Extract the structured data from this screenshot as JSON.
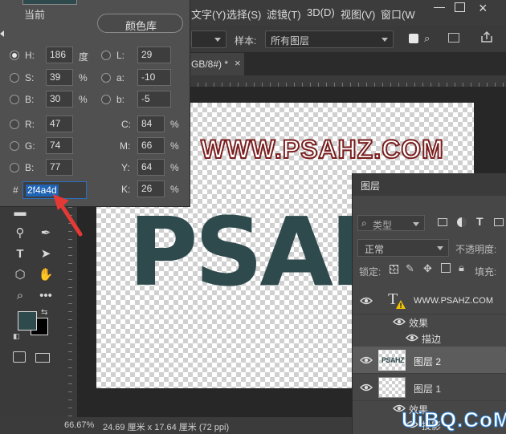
{
  "menu": {
    "items": [
      "文字(Y)",
      "选择(S)",
      "滤镜(T)",
      "3D(D)",
      "视图(V)",
      "窗口(W"
    ]
  },
  "options": {
    "sample_label": "样本:",
    "sample_value": "所有图层"
  },
  "tab": {
    "title": "GB/8#) *",
    "close": "×"
  },
  "picker": {
    "current_label": "当前",
    "library_button": "颜色库",
    "hsb": {
      "h_label": "H:",
      "h": "186",
      "h_unit": "度",
      "s_label": "S:",
      "s": "39",
      "s_unit": "%",
      "b_label": "B:",
      "b": "30",
      "b_unit": "%"
    },
    "lab": {
      "l_label": "L:",
      "l": "29",
      "a_label": "a:",
      "a": "-10",
      "b_label": "b:",
      "b": "-5"
    },
    "rgb": {
      "r_label": "R:",
      "r": "47",
      "g_label": "G:",
      "g": "74",
      "b_label": "B:",
      "b": "77"
    },
    "cmyk": {
      "c_label": "C:",
      "c": "84",
      "c_unit": "%",
      "m_label": "M:",
      "m": "66",
      "m_unit": "%",
      "y_label": "Y:",
      "y": "64",
      "y_unit": "%",
      "k_label": "K:",
      "k": "26",
      "k_unit": "%"
    },
    "hex_label": "#",
    "hex": "2f4a4d",
    "selected_color": "#2f4a4d"
  },
  "canvas": {
    "watermark": "WWW.PSAHZ.COM",
    "art_text": "PSAHZ"
  },
  "layers": {
    "title": "图层",
    "filter_placeholder": "类型",
    "blend_mode": "正常",
    "opacity_label": "不透明度:",
    "lock_label": "锁定:",
    "fill_label": "填充:",
    "rows": [
      {
        "name": "WWW.PSAHZ.COM",
        "type": "text"
      },
      {
        "name": "效果",
        "type": "effects"
      },
      {
        "name": "描边",
        "type": "effect"
      },
      {
        "name": "图层 2",
        "type": "pixel",
        "thumb_text": "PSAHZ"
      },
      {
        "name": "图层 1",
        "type": "pixel"
      },
      {
        "name": "效果",
        "type": "effects"
      },
      {
        "name": "投影",
        "type": "effect"
      }
    ]
  },
  "status": {
    "zoom": "66.67%",
    "doc_size": "24.69 厘米 x 17.64 厘米 (72 ppi)"
  },
  "site_watermark": "UiBQ.CoM",
  "colors": {
    "foreground": "#2f4a4d",
    "background": "#000000",
    "annotation_arrow": "#e53935",
    "hex_highlight": "#1e63b4"
  }
}
